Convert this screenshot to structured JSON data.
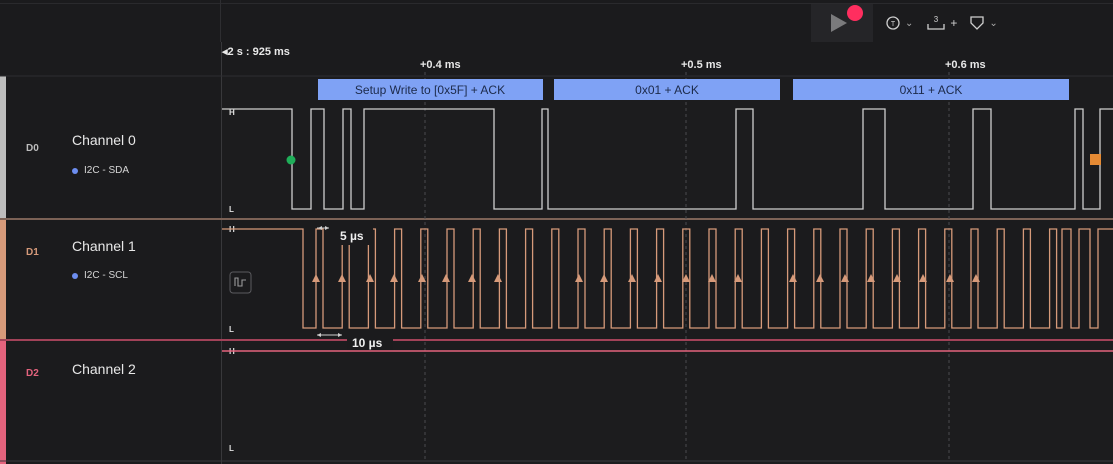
{
  "toolbar": {
    "icons": [
      "play-icon",
      "record-dot-icon",
      "trigger-icon",
      "measure-icon",
      "marker-icon"
    ],
    "measure_superscript": "3",
    "plus": "+",
    "chevron": "⌄"
  },
  "timeline": {
    "origin_label": "◂2 s : 925 ms",
    "ticks": [
      "+0.4 ms",
      "+0.5 ms",
      "+0.6 ms"
    ]
  },
  "channels": [
    {
      "id": "D0",
      "name": "Channel 0",
      "analyzer": "I2C - SDA",
      "color": "#bdbdbd",
      "hi": "H",
      "lo": "L"
    },
    {
      "id": "D1",
      "name": "Channel 1",
      "analyzer": "I2C - SCL",
      "color": "#d69a7a",
      "hi": "H",
      "lo": "L"
    },
    {
      "id": "D2",
      "name": "Channel 2",
      "analyzer": "",
      "color": "#e4637d",
      "hi": "H",
      "lo": "L"
    }
  ],
  "decoded_frames": [
    {
      "label": "Setup Write to [0x5F] + ACK"
    },
    {
      "label": "0x01 + ACK"
    },
    {
      "label": "0x11 + ACK"
    }
  ],
  "measurements": {
    "pulse_width": "5 µs",
    "period": "10 µs"
  },
  "colors": {
    "frame_bg": "#7fa2f5",
    "sda_start_marker": "#1fae59",
    "sda_end_marker": "#e58a34",
    "record_dot": "#ff2e5f"
  }
}
